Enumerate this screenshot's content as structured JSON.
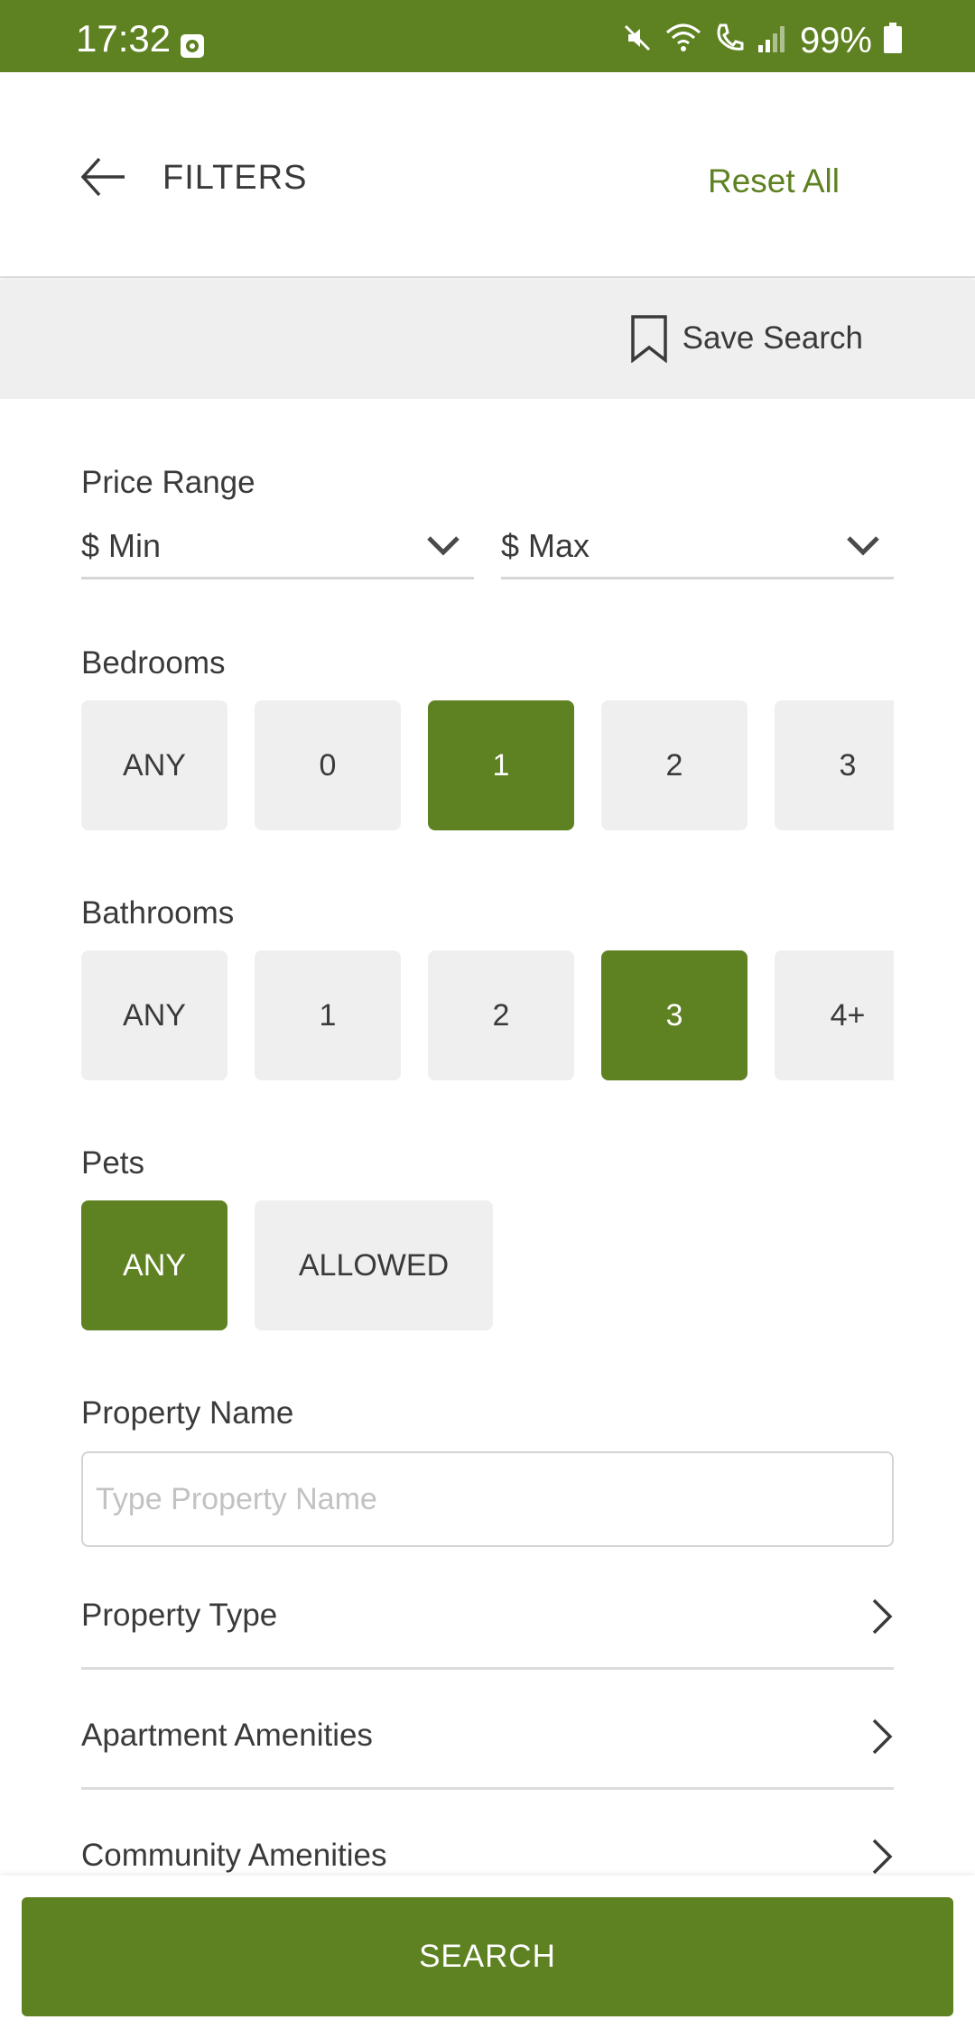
{
  "status_bar": {
    "time": "17:32",
    "battery": "99%",
    "icons": [
      "mute-icon",
      "wifi-icon",
      "volte-call-icon",
      "signal-icon",
      "battery-icon"
    ]
  },
  "header": {
    "title": "FILTERS",
    "reset_label": "Reset All"
  },
  "save_search": {
    "label": "Save Search"
  },
  "price_range": {
    "label": "Price Range",
    "min_value": "$ Min",
    "max_value": "$ Max"
  },
  "bedrooms": {
    "label": "Bedrooms",
    "options": [
      "ANY",
      "0",
      "1",
      "2",
      "3"
    ],
    "selected": "1"
  },
  "bathrooms": {
    "label": "Bathrooms",
    "options": [
      "ANY",
      "1",
      "2",
      "3",
      "4+"
    ],
    "selected": "3"
  },
  "pets": {
    "label": "Pets",
    "options": [
      "ANY",
      "ALLOWED"
    ],
    "selected": "ANY"
  },
  "property_name": {
    "label": "Property Name",
    "placeholder": "Type Property Name",
    "value": ""
  },
  "nav_rows": [
    {
      "label": "Property Type"
    },
    {
      "label": "Apartment Amenities"
    },
    {
      "label": "Community Amenities"
    }
  ],
  "search_button": {
    "label": "SEARCH"
  },
  "colors": {
    "accent": "#5e8121",
    "chip_bg": "#efefef",
    "text": "#3a3a3a"
  }
}
